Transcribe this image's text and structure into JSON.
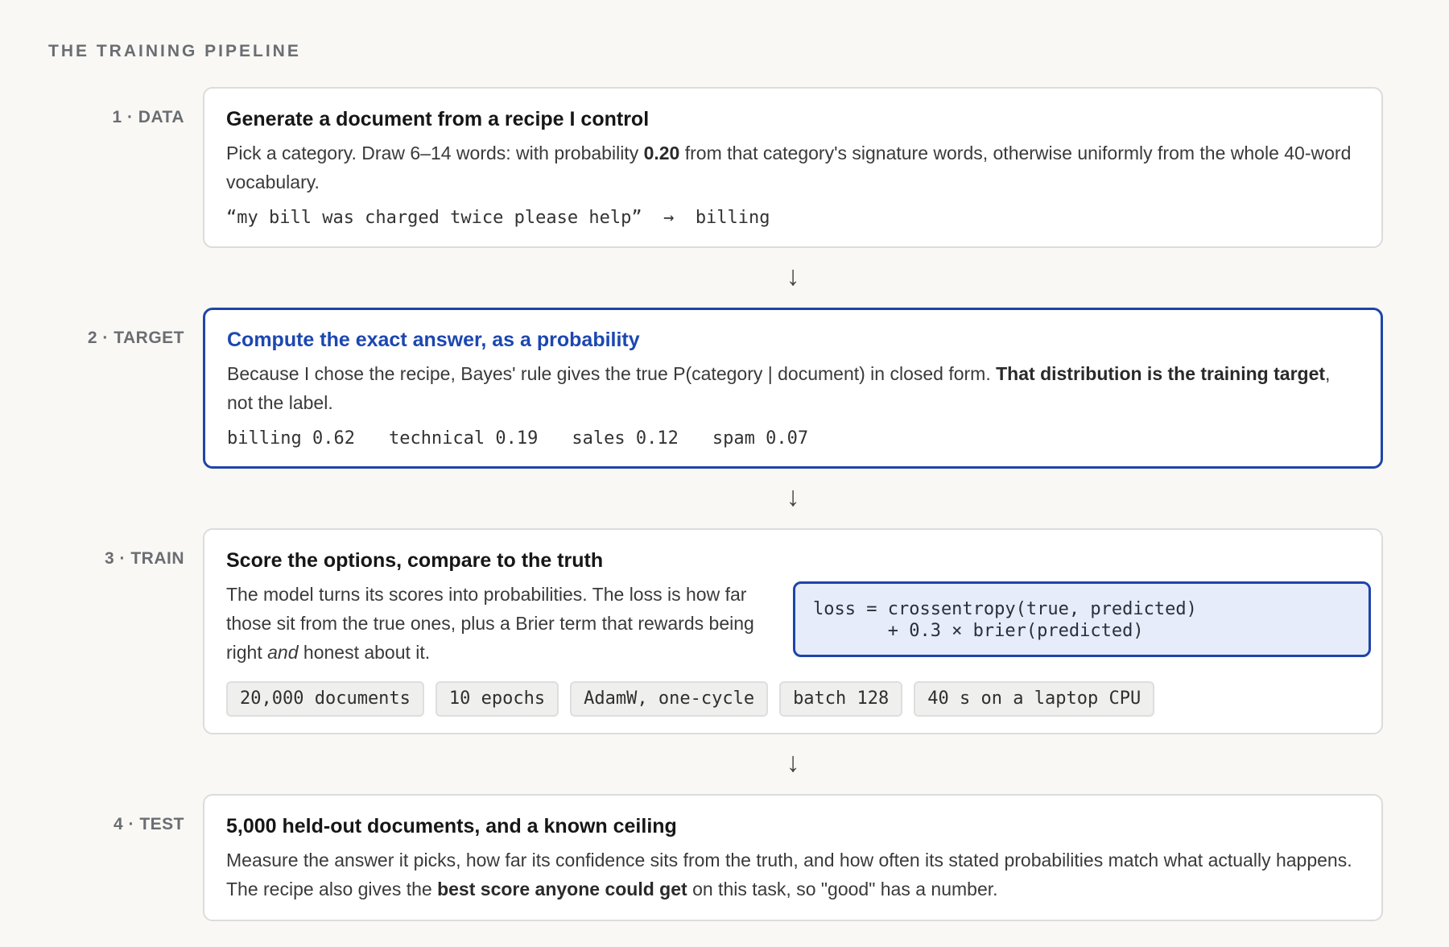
{
  "heading": "THE TRAINING PIPELINE",
  "arrow_glyph": "↓",
  "steps": [
    {
      "label": "1 · DATA",
      "title": "Generate a document from a recipe I control",
      "text_a": "Pick a category. Draw 6–14 words: with probability ",
      "text_bold": "0.20",
      "text_b": " from that category's signature words, otherwise uniformly from the whole 40-word vocabulary.",
      "example_doc": "“my bill was charged twice please help”",
      "example_arrow": "→",
      "example_label": "billing"
    },
    {
      "label": "2 · TARGET",
      "title": "Compute the exact answer, as a probability",
      "text_a": "Because I chose the recipe, Bayes' rule gives the true P(category | document) in closed form. ",
      "text_bold": "That distribution is the training target",
      "text_b": ", not the label.",
      "distribution": [
        {
          "name": "billing",
          "value": "0.62"
        },
        {
          "name": "technical",
          "value": "0.19"
        },
        {
          "name": "sales",
          "value": "0.12"
        },
        {
          "name": "spam",
          "value": "0.07"
        }
      ]
    },
    {
      "label": "3 · TRAIN",
      "title": "Score the options, compare to the truth",
      "text_a": "The model turns its scores into probabilities. The loss is how far those sit from the true ones, plus a Brier term that rewards being right ",
      "text_em": "and",
      "text_b": " honest about it.",
      "code_line_1": "loss = crossentropy(true, predicted)",
      "code_line_2": "       + 0.3 × brier(predicted)",
      "chips": [
        "20,000 documents",
        "10 epochs",
        "AdamW, one-cycle",
        "batch 128",
        "40 s on a laptop CPU"
      ]
    },
    {
      "label": "4 · TEST",
      "title": "5,000 held-out documents, and a known ceiling",
      "text_a": "Measure the answer it picks, how far its confidence sits from the truth, and how often its stated probabilities match what actually happens. The recipe also gives the ",
      "text_bold": "best score anyone could get",
      "text_b": " on this task, so \"good\" has a number."
    }
  ]
}
